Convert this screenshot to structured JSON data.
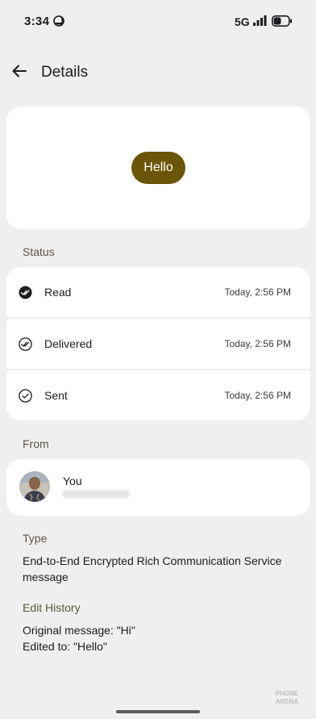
{
  "status_bar": {
    "time": "3:34",
    "network": "5G",
    "icons": [
      "moon-icon",
      "signal-icon",
      "battery-icon"
    ]
  },
  "app_bar": {
    "back_icon": "arrow-left-icon",
    "title": "Details"
  },
  "message_preview": {
    "text": "Hello",
    "bubble_color": "#6b5508"
  },
  "status_section": {
    "label": "Status",
    "items": [
      {
        "label": "Read",
        "time": "Today, 2:56 PM",
        "icon": "double-check-filled-icon"
      },
      {
        "label": "Delivered",
        "time": "Today, 2:56 PM",
        "icon": "double-check-outline-icon"
      },
      {
        "label": "Sent",
        "time": "Today, 2:56 PM",
        "icon": "check-outline-icon"
      }
    ]
  },
  "from_section": {
    "label": "From",
    "name": "You"
  },
  "type_section": {
    "label": "Type",
    "value": "End-to-End Encrypted Rich Communication Service message"
  },
  "edit_history_section": {
    "label": "Edit History",
    "original": "Original message: \"Hi\"",
    "edited": "Edited to: \"Hello\""
  },
  "watermark": "PHONE ARENA"
}
